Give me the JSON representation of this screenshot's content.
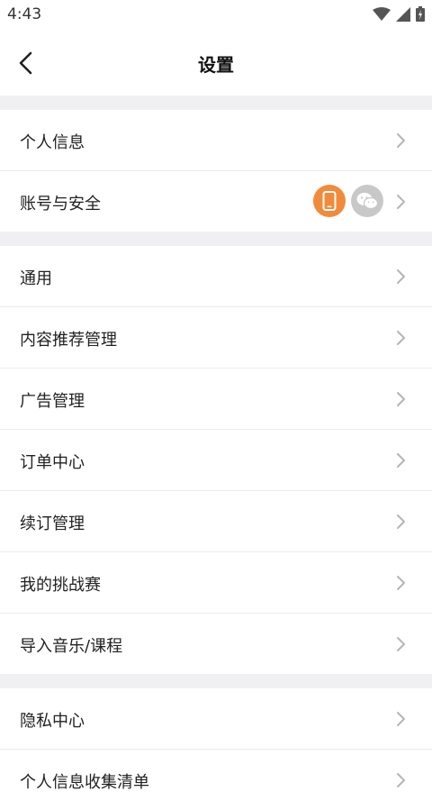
{
  "status_bar": {
    "time": "4:43"
  },
  "header": {
    "title": "设置"
  },
  "sections": [
    {
      "items": [
        {
          "label": "个人信息"
        },
        {
          "label": "账号与安全",
          "badges": [
            "phone-icon",
            "wechat-icon"
          ]
        }
      ]
    },
    {
      "items": [
        {
          "label": "通用"
        },
        {
          "label": "内容推荐管理"
        },
        {
          "label": "广告管理"
        },
        {
          "label": "订单中心"
        },
        {
          "label": "续订管理"
        },
        {
          "label": "我的挑战赛"
        },
        {
          "label": "导入音乐/课程"
        }
      ]
    },
    {
      "items": [
        {
          "label": "隐私中心"
        },
        {
          "label": "个人信息收集清单"
        }
      ]
    }
  ],
  "colors": {
    "accent": "#f28a3b",
    "inactive_badge": "#c8c8c8",
    "section_gap": "#f0f0f3"
  }
}
